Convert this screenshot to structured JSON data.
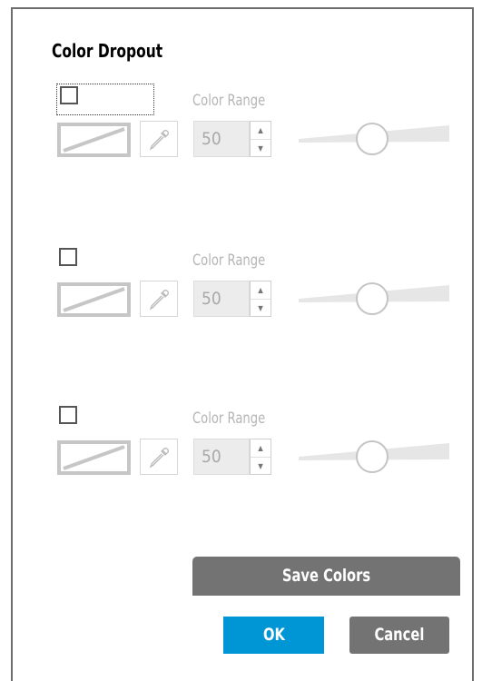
{
  "dialog": {
    "title": "Color Dropout"
  },
  "color_groups": [
    {
      "checked": false,
      "range_label": "Color Range",
      "range_value": "50",
      "slider_level": 0.5,
      "focused": true
    },
    {
      "checked": false,
      "range_label": "Color Range",
      "range_value": "50",
      "slider_level": 0.5,
      "focused": false
    },
    {
      "checked": false,
      "range_label": "Color Range",
      "range_value": "50",
      "slider_level": 0.5,
      "focused": false
    }
  ],
  "buttons": {
    "save_label": "Save Colors",
    "ok_label": "OK",
    "cancel_label": "Cancel"
  },
  "colors": {
    "ok_blue": "#0096d6",
    "button_gray": "#737373",
    "disabled_text": "#b5b5b5"
  },
  "icons": {
    "swatch": "no-color-swatch-icon",
    "dropper": "eyedropper-icon",
    "spin_up": "chevron-up-icon",
    "spin_down": "chevron-down-icon"
  }
}
